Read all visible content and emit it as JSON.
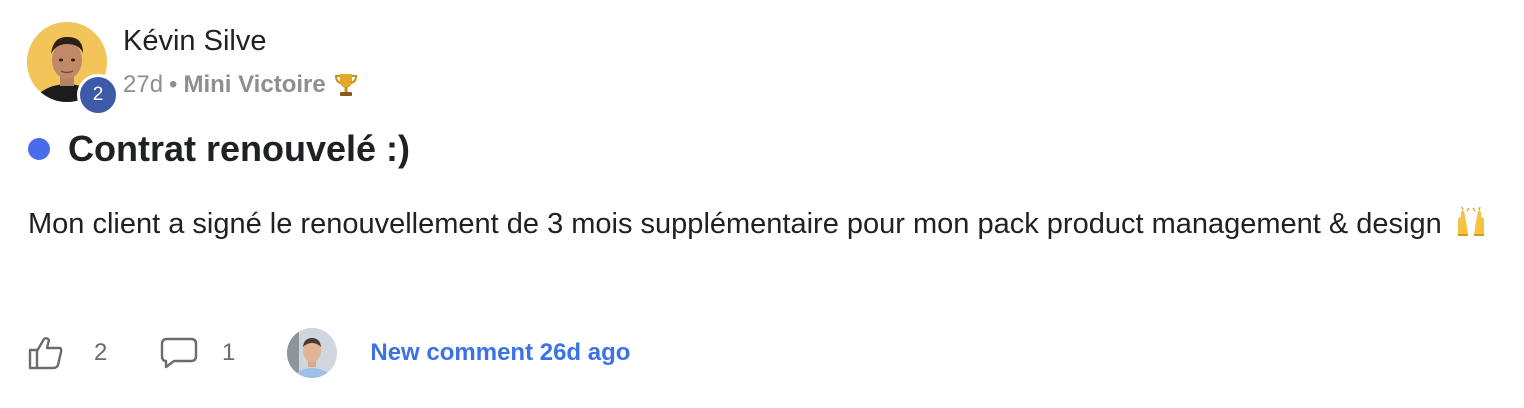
{
  "post": {
    "author": {
      "name": "Kévin Silve",
      "level": "2",
      "avatar_icon": "user-avatar-photo"
    },
    "meta": {
      "age": "27d",
      "separator": "•",
      "category": "Mini Victoire",
      "category_icon": "trophy-icon"
    },
    "title": "Contrat renouvelé :)",
    "unread_color": "#4b6bef",
    "body": "Mon client a signé le renouvellement de 3 mois supplémentaire pour mon pack product management & design",
    "body_emoji_icon": "raising-hands-icon",
    "footer": {
      "like_icon": "thumbs-up-icon",
      "likes": "2",
      "comment_icon": "comment-bubble-icon",
      "comments": "1",
      "commenter_avatar": "commenter-avatar-photo",
      "new_comment": "New comment 26d ago"
    }
  },
  "colors": {
    "link": "#3b72e8",
    "muted": "#8e8e93",
    "badge": "#3d5aa8",
    "avatar_bg": "#f2c45a"
  }
}
